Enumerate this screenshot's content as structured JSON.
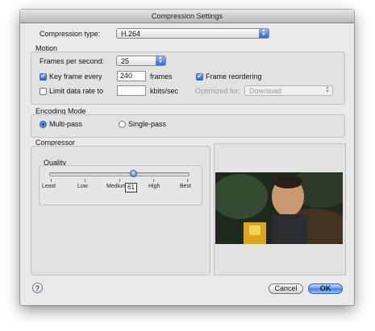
{
  "window": {
    "title": "Compression Settings"
  },
  "compression_type": {
    "label": "Compression type:",
    "value": "H.264"
  },
  "motion": {
    "title": "Motion",
    "fps_label": "Frames per second:",
    "fps_value": "25",
    "key_frame": {
      "label": "Key frame every",
      "checked": true,
      "value": "240",
      "unit": "frames"
    },
    "frame_reordering": {
      "label": "Frame reordering",
      "checked": true
    },
    "limit_rate": {
      "label": "Limit data rate to",
      "checked": false,
      "value": "",
      "unit": "kbits/sec"
    },
    "optimized_for": {
      "label": "Optimized for:",
      "value": "Download"
    }
  },
  "encoding_mode": {
    "title": "Encoding Mode",
    "multi_pass": "Multi-pass",
    "single_pass": "Single-pass",
    "selected": "Multi-pass"
  },
  "compressor": {
    "title": "Compressor",
    "quality": {
      "title": "Quality",
      "value": "61",
      "level": 0.61,
      "scale": [
        "Least",
        "Low",
        "Medium",
        "High",
        "Best"
      ]
    }
  },
  "buttons": {
    "help": "?",
    "cancel": "Cancel",
    "ok": "OK"
  },
  "colors": {
    "accent": "#3e7fe0",
    "window_bg": "#e9e9e9"
  }
}
